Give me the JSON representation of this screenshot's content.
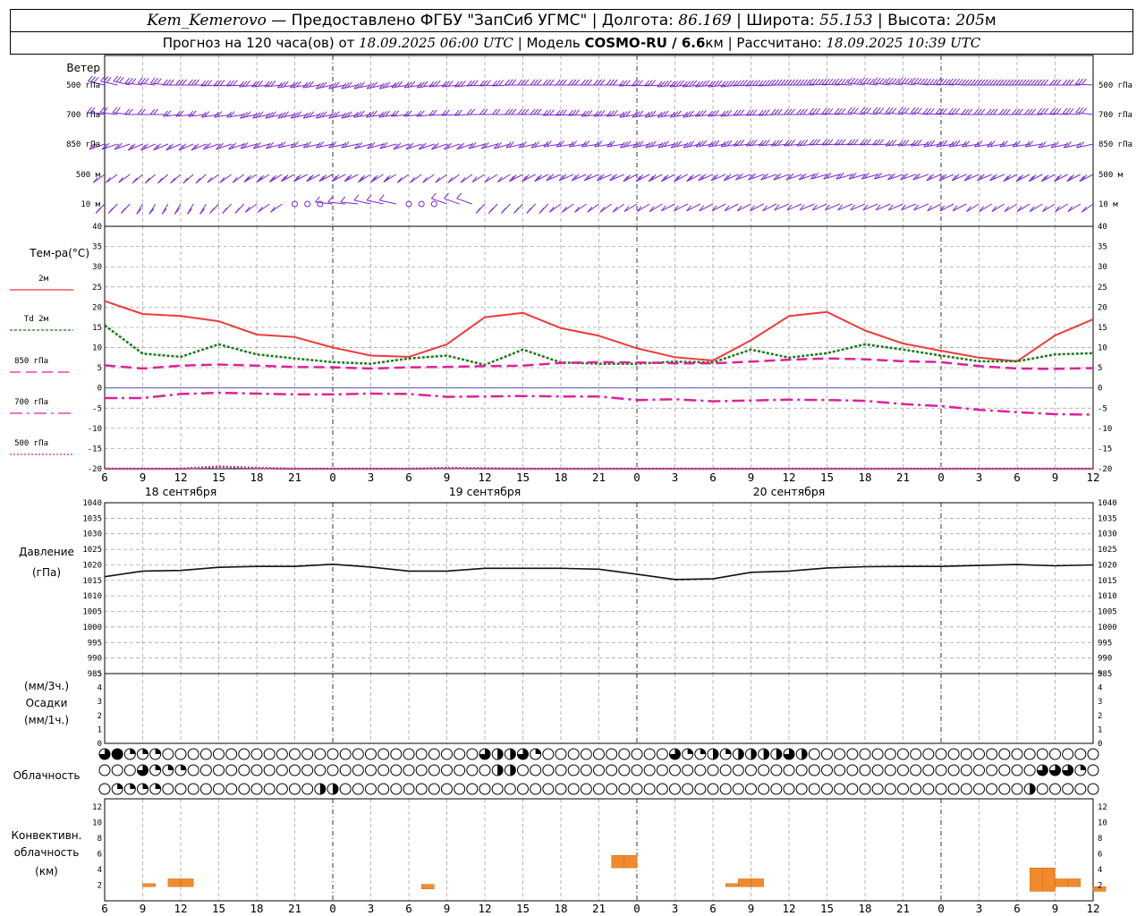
{
  "header": {
    "station": "Kem_Kemerovo",
    "provider": " — Предоставлено ФГБУ \"ЗапСиб УГМС\" | ",
    "lon_label": "Долгота: ",
    "lon_value": "86.169",
    "lat_label": " | Широта: ",
    "lat_value": "55.153",
    "alt_label": " | Высота: ",
    "alt_value": "205",
    "alt_unit": "м",
    "forecast_label": "Прогноз на 120 часа(ов) от ",
    "forecast_time": "18.09.2025 06:00 UTC",
    "model_label": " | Модель ",
    "model_name": "COSMO-RU / 6.6",
    "model_unit": "км",
    "calc_label": " | Рассчитано: ",
    "calc_time": "18.09.2025 10:39 UTC"
  },
  "labels": {
    "wind": "Ветер",
    "temp": "Тем-ра(°C)",
    "pressure": "Давление",
    "pressure_unit": "(гПа)",
    "precip_unit3": "(мм/3ч.)",
    "precip": "Осадки",
    "precip_unit1": "(мм/1ч.)",
    "cloud": "Облачность",
    "conv1": "Конвективн.",
    "conv2": "облачность",
    "conv3": "(км)"
  },
  "wind_levels": [
    "500 гПа",
    "700 гПа",
    "850 гПа",
    "500 м",
    "10  м"
  ],
  "days": [
    "18 сентября",
    "19 сентября",
    "20 сентября"
  ],
  "x_tick_labels": [
    "6",
    "9",
    "12",
    "15",
    "18",
    "21",
    "0",
    "3",
    "6",
    "9",
    "12",
    "15",
    "18",
    "21",
    "0",
    "3",
    "6",
    "9",
    "12",
    "15",
    "18",
    "21",
    "0",
    "3",
    "6",
    "9",
    "12"
  ],
  "colors": {
    "t2m": "#ee3b3b",
    "td2m": "#1a7a1a",
    "t850": "#e0209a",
    "t700": "#e0209a",
    "t500": "#e0209a",
    "wind": "#7a28d0",
    "conv": "#f08a2a",
    "grid": "#9a9a9a"
  },
  "chart_data": [
    {
      "type": "line",
      "ylabel": "Тем-ра(°C)",
      "ylim": [
        -20,
        40
      ],
      "yticks": [
        -20,
        -15,
        -10,
        -5,
        0,
        5,
        10,
        15,
        20,
        25,
        30,
        35,
        40
      ],
      "x_hours": [
        0,
        3,
        6,
        9,
        12,
        15,
        18,
        21,
        24,
        27,
        30,
        33,
        36,
        39,
        42,
        45,
        48,
        51,
        54,
        57,
        60,
        63,
        66,
        69,
        72,
        75,
        78
      ],
      "series": [
        {
          "name": "2м",
          "values": [
            21.5,
            18.3,
            17.8,
            16.5,
            13.2,
            12.6,
            10,
            8,
            7.7,
            10.8,
            17.5,
            18.6,
            14.8,
            12.9,
            9.8,
            7.6,
            6.8,
            11.8,
            17.8,
            18.8,
            14.2,
            11,
            9.2,
            7.5,
            6.6,
            13,
            17
          ]
        },
        {
          "name": "Td 2м",
          "values": [
            15.5,
            8.5,
            7.7,
            10.8,
            8.3,
            7.3,
            6.4,
            6,
            7.3,
            8,
            5.7,
            9.5,
            6.3,
            6,
            6,
            6.5,
            6.3,
            9.5,
            7.5,
            8.6,
            10.8,
            9.5,
            8,
            6.6,
            6.6,
            8.3,
            8.6
          ]
        },
        {
          "name": "850 гПа",
          "values": [
            5.6,
            4.8,
            5.5,
            5.8,
            5.5,
            5.2,
            5.1,
            4.8,
            5.1,
            5.2,
            5.4,
            5.5,
            6.2,
            6.4,
            6.3,
            6.1,
            6.1,
            6.5,
            7,
            7.3,
            7.1,
            6.6,
            6.4,
            5.4,
            4.8,
            4.7,
            4.9
          ]
        },
        {
          "name": "700 гПа",
          "values": [
            -2.5,
            -2.5,
            -1.5,
            -1.2,
            -1.4,
            -1.6,
            -1.6,
            -1.4,
            -1.5,
            -2.2,
            -2.1,
            -2,
            -2.1,
            -2.1,
            -3,
            -2.8,
            -3.3,
            -3.1,
            -2.9,
            -3,
            -3.2,
            -4,
            -4.5,
            -5.4,
            -6,
            -6.5,
            -6.6
          ]
        },
        {
          "name": "500 гПа",
          "values": [
            -21,
            -20.3,
            -20,
            -19.5,
            -19.8,
            -20,
            -21,
            -20.1,
            -20,
            -19.8,
            -19.9,
            -20.1,
            -21,
            -21,
            -21,
            -21,
            -21,
            -21,
            -21,
            -21,
            -21,
            -21,
            -21,
            -21,
            -21,
            -21,
            -21
          ]
        }
      ]
    },
    {
      "type": "line",
      "ylabel": "Давление",
      "ylim": [
        985,
        1040
      ],
      "yticks": [
        985,
        990,
        995,
        1000,
        1005,
        1010,
        1015,
        1020,
        1025,
        1030,
        1035,
        1040
      ],
      "x_hours": [
        0,
        3,
        6,
        9,
        12,
        15,
        18,
        21,
        24,
        27,
        30,
        33,
        36,
        39,
        42,
        45,
        48,
        51,
        54,
        57,
        60,
        63,
        66,
        69,
        72,
        75,
        78
      ],
      "series": [
        {
          "name": "Давление",
          "values": [
            1016.2,
            1018,
            1018.2,
            1019.2,
            1019.5,
            1019.5,
            1020.2,
            1019.3,
            1018,
            1018,
            1018.9,
            1018.9,
            1018.9,
            1018.6,
            1017,
            1015.3,
            1015.5,
            1017.6,
            1018,
            1019,
            1019.4,
            1019.5,
            1019.5,
            1019.8,
            1020.1,
            1019.7,
            1020
          ]
        }
      ]
    },
    {
      "type": "bar",
      "ylabel": "Осадки",
      "ylim": [
        0,
        5
      ],
      "yticks": [
        0,
        1,
        2,
        3,
        4,
        5
      ],
      "values": []
    },
    {
      "type": "bar",
      "ylabel": "Конвективн. облачность",
      "ylim": [
        0,
        13
      ],
      "yticks": [
        0,
        2,
        4,
        6,
        8,
        10,
        12
      ],
      "bars": [
        {
          "hour": 3,
          "bottom": 1.8,
          "top": 2.2
        },
        {
          "hour": 5,
          "bottom": 1.8,
          "top": 2.8
        },
        {
          "hour": 6,
          "bottom": 1.8,
          "top": 2.8
        },
        {
          "hour": 25,
          "bottom": 1.5,
          "top": 2.1
        },
        {
          "hour": 40,
          "bottom": 4.2,
          "top": 5.8
        },
        {
          "hour": 41,
          "bottom": 4.2,
          "top": 5.8
        },
        {
          "hour": 49,
          "bottom": 1.8,
          "top": 2.2
        },
        {
          "hour": 50,
          "bottom": 1.8,
          "top": 2.8
        },
        {
          "hour": 51,
          "bottom": 1.8,
          "top": 2.8
        },
        {
          "hour": 73,
          "bottom": 1.2,
          "top": 4.2
        },
        {
          "hour": 74,
          "bottom": 1.2,
          "top": 4.2
        },
        {
          "hour": 75,
          "bottom": 1.8,
          "top": 2.8
        },
        {
          "hour": 76,
          "bottom": 1.8,
          "top": 2.8
        },
        {
          "hour": 78,
          "bottom": 1.2,
          "top": 1.8
        }
      ]
    }
  ],
  "cloud_rows": [
    "341110000000000000000000000000322310000000000311212222320000000000000000000000000",
    "000311100000000000000000000000022000000000000000000000000000000000000000003331010",
    "011110000000000002200000000000000000000000000000000000000000000000000000020000000"
  ],
  "wind_barbs": [
    {
      "dir": [
        290,
        280,
        270,
        265,
        260,
        255,
        250,
        250,
        255,
        260,
        265,
        270,
        270,
        270,
        265,
        260,
        260,
        265,
        270,
        275,
        280,
        280,
        275,
        270,
        270,
        270,
        275
      ],
      "speed": [
        25,
        25,
        25,
        25,
        30,
        30,
        30,
        30,
        25,
        25,
        25,
        25,
        25,
        30,
        30,
        35,
        35,
        35,
        35,
        35,
        35,
        35,
        35,
        35,
        35,
        30,
        30
      ]
    },
    {
      "dir": [
        280,
        270,
        260,
        255,
        250,
        250,
        250,
        255,
        260,
        265,
        270,
        270,
        265,
        260,
        255,
        255,
        260,
        265,
        270,
        275,
        280,
        280,
        275,
        270,
        270,
        275,
        280
      ],
      "speed": [
        20,
        20,
        20,
        20,
        25,
        25,
        25,
        25,
        20,
        20,
        20,
        25,
        25,
        25,
        30,
        30,
        30,
        30,
        30,
        30,
        30,
        30,
        30,
        30,
        30,
        25,
        25
      ]
    },
    {
      "dir": [
        240,
        235,
        235,
        240,
        245,
        250,
        250,
        245,
        240,
        240,
        245,
        250,
        255,
        255,
        250,
        250,
        255,
        260,
        260,
        265,
        265,
        260,
        255,
        255,
        255,
        250,
        250
      ],
      "speed": [
        15,
        15,
        15,
        15,
        20,
        20,
        20,
        20,
        15,
        15,
        15,
        20,
        20,
        20,
        25,
        25,
        25,
        25,
        25,
        25,
        25,
        25,
        25,
        20,
        20,
        20,
        20
      ]
    },
    {
      "dir": [
        220,
        215,
        215,
        220,
        225,
        230,
        230,
        225,
        220,
        220,
        225,
        230,
        235,
        235,
        230,
        230,
        235,
        240,
        240,
        245,
        245,
        240,
        235,
        235,
        230,
        230,
        230
      ],
      "speed": [
        10,
        10,
        10,
        10,
        15,
        15,
        15,
        15,
        10,
        10,
        10,
        15,
        15,
        15,
        20,
        20,
        20,
        20,
        20,
        20,
        20,
        20,
        20,
        15,
        15,
        15,
        15
      ]
    },
    {
      "dir": [
        210,
        200,
        200,
        210,
        220,
        0,
        280,
        290,
        0,
        300,
        210,
        210,
        220,
        220,
        225,
        230,
        230,
        230,
        235,
        235,
        235,
        235,
        230,
        225,
        225,
        225,
        220
      ],
      "speed": [
        5,
        5,
        5,
        5,
        5,
        0,
        5,
        5,
        0,
        5,
        5,
        5,
        10,
        10,
        10,
        10,
        10,
        10,
        10,
        10,
        10,
        10,
        10,
        10,
        10,
        10,
        10
      ]
    }
  ]
}
